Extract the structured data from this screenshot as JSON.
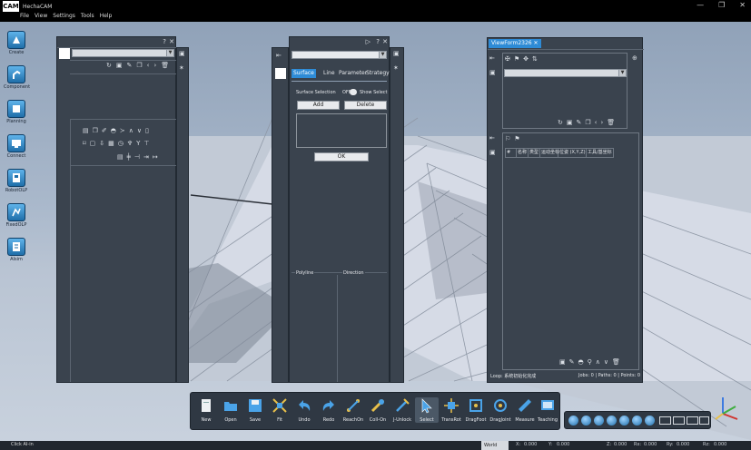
{
  "app": {
    "title": "HechaCAM",
    "logo": "CAM"
  },
  "window_controls": [
    "—",
    "❐",
    "✕"
  ],
  "menu": [
    "File",
    "View",
    "Settings",
    "Tools",
    "Help"
  ],
  "left_toolbar": [
    {
      "label": "Create",
      "icon": "create-icon"
    },
    {
      "label": "Component",
      "icon": "component-icon"
    },
    {
      "label": "Planning",
      "icon": "planning-icon"
    },
    {
      "label": "Connect",
      "icon": "connect-icon"
    },
    {
      "label": "RobotOLP",
      "icon": "robotolp-icon"
    },
    {
      "label": "FixedOLP",
      "icon": "fixedolp-icon"
    },
    {
      "label": "AIsim",
      "icon": "aisim-icon"
    }
  ],
  "panel2": {
    "tabs": [
      "Surface",
      "Line",
      "Parameter",
      "Strategy"
    ],
    "surface_selection_label": "Surface Selection",
    "toggle_off": "OFF",
    "show_select": "Show Select",
    "add": "Add",
    "delete": "Delete",
    "ok": "OK",
    "polyline": "Polyline",
    "direction": "Direction"
  },
  "viewform": {
    "tab_label": "ViewForm2326",
    "table_headers": [
      "#",
      "名称",
      "类型",
      "运动坐标",
      "位姿 (X,Y,Z)",
      "工具/基坐标"
    ],
    "loop_label": "Loop:",
    "loop_value": "系统初始化完成",
    "stats": "Jobs: 0 | Paths: 0 | Points: 0"
  },
  "bottom_toolbar": [
    {
      "label": "New"
    },
    {
      "label": "Open"
    },
    {
      "label": "Save"
    },
    {
      "label": "Fit"
    },
    {
      "label": "Undo"
    },
    {
      "label": "Redo"
    },
    {
      "label": "ReachOn"
    },
    {
      "label": "Coll-On"
    },
    {
      "label": "J-Unlock"
    },
    {
      "label": "Select"
    },
    {
      "label": "TransRot"
    },
    {
      "label": "DragFoot"
    },
    {
      "label": "DragJoint"
    },
    {
      "label": "Measure"
    },
    {
      "label": "Teaching"
    }
  ],
  "statusbar": {
    "message": "Click AI-in",
    "frame": "World",
    "coords": [
      {
        "k": "X:",
        "v": "0.000"
      },
      {
        "k": "Y:",
        "v": "0.000"
      },
      {
        "k": "Z:",
        "v": "0.000"
      },
      {
        "k": "Rx:",
        "v": "0.000"
      },
      {
        "k": "Ry:",
        "v": "0.000"
      },
      {
        "k": "Rz:",
        "v": "0.000"
      }
    ]
  },
  "colors": {
    "accent": "#2e8bd6",
    "panel": "#3a434e",
    "toolbar": "#2f3843"
  }
}
